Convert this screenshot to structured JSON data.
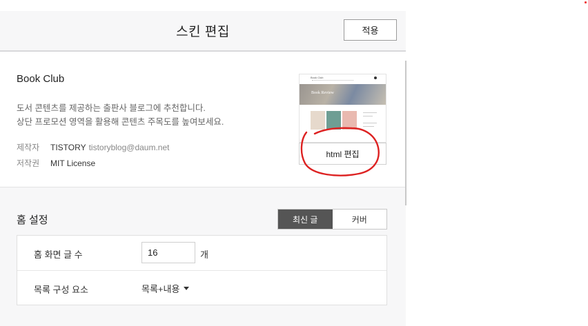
{
  "header": {
    "title": "스킨 편집",
    "apply_label": "적용"
  },
  "skin": {
    "name": "Book Club",
    "description": [
      "도서 콘텐츠를 제공하는 출판사 블로그에 추천합니다.",
      "상단 프로모션 영역을 활용해 콘텐츠 주목도를 높여보세요."
    ],
    "maker_label": "제작자",
    "maker": "TISTORY",
    "maker_email": "tistoryblog@daum.net",
    "license_label": "저작권",
    "license": "MIT License",
    "html_edit_label": "html 편집",
    "thumbnail": {
      "logo": "Book Club",
      "hero_text": "Book Review"
    }
  },
  "home": {
    "title": "홈 설정",
    "tabs": [
      {
        "label": "최신 글",
        "active": true
      },
      {
        "label": "커버",
        "active": false
      }
    ],
    "post_count_label": "홈 화면 글 수",
    "post_count_value": "16",
    "post_count_unit": "개",
    "list_component_label": "목록 구성 요소",
    "list_component_value": "목록+내용"
  },
  "colors": {
    "annotation": "#dd2222",
    "active_tab": "#555555",
    "header_bg": "#f7f7f8"
  },
  "icons": {
    "dropdown": "caret-down-icon",
    "menu": "menu-dot-icon"
  }
}
